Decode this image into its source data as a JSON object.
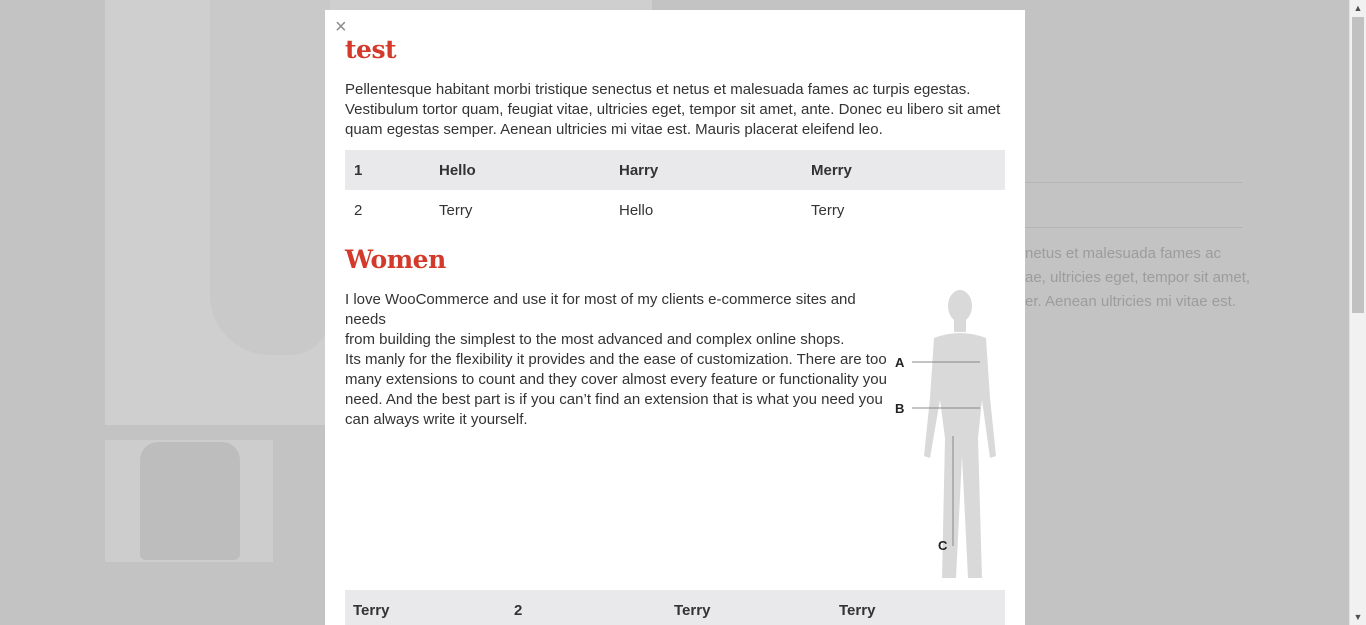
{
  "modal": {
    "close_label": "×",
    "section1": {
      "title": "test",
      "paragraph_lines": [
        "Pellentesque habitant morbi tristique senectus et netus et malesuada fames ac turpis egestas.",
        "Vestibulum tortor quam, feugiat vitae, ultricies eget, tempor sit amet, ante. Donec eu libero sit amet",
        "quam egestas semper. Aenean ultricies mi vitae est. Mauris placerat eleifend leo."
      ],
      "table": [
        [
          "1",
          "Hello",
          "Harry",
          "Merry"
        ],
        [
          "2",
          "Terry",
          "Hello",
          "Terry"
        ]
      ]
    },
    "section2": {
      "title": "Women",
      "paragraph_lines": [
        "I love WooCommerce and use it for most of my clients e-commerce sites and needs",
        "from building the simplest to the most advanced and complex online shops.",
        "Its manly for the flexibility it provides and the ease of customization. There are too",
        "many extensions to count and they cover almost every feature or functionality you",
        "need. And the best part is if you can’t find an extension that is what you need you",
        "can always write it yourself."
      ],
      "figure_labels": {
        "a": "A",
        "b": "B",
        "c": "C"
      },
      "table": [
        [
          "Terry",
          "2",
          "Terry",
          "Terry"
        ]
      ]
    }
  },
  "background": {
    "text_lines": [
      "netus et malesuada fames ac",
      "ae, ultricies eget, tempor sit amet,",
      "er. Aenean ultricies mi vitae est."
    ]
  },
  "scrollbar": {
    "up_arrow": "▲",
    "down_arrow": "▼"
  }
}
